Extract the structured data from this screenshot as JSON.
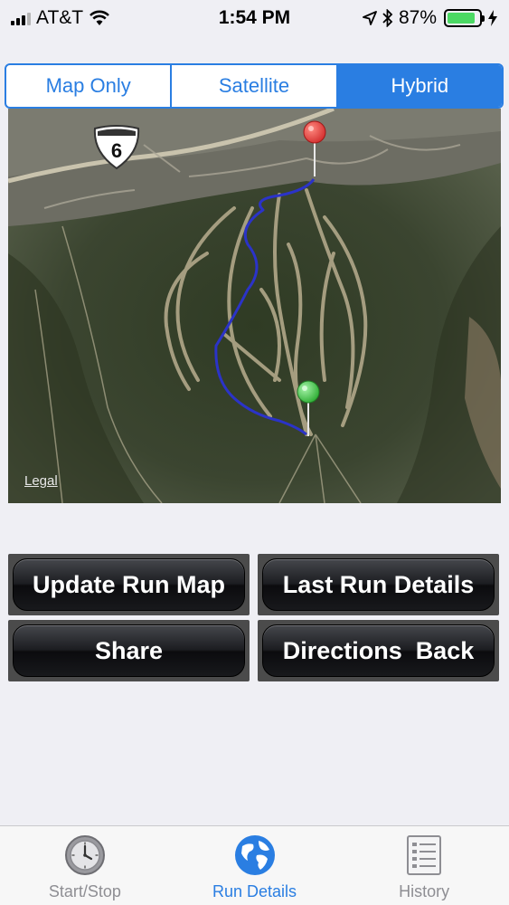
{
  "status_bar": {
    "carrier": "AT&T",
    "time": "1:54 PM",
    "battery_percent": "87%",
    "battery_level": 0.87,
    "battery_color": "#4cd964"
  },
  "map_type": {
    "options": [
      "Map Only",
      "Satellite",
      "Hybrid"
    ],
    "selected": "Hybrid",
    "accent": "#2a7ee2"
  },
  "map": {
    "highway_shield": "6",
    "legal_link": "Legal",
    "start_pin_color": "#e53935",
    "end_pin_color": "#43c447",
    "route_color": "#2b33c8"
  },
  "buttons": {
    "update_run_map": "Update Run Map",
    "last_run_details": "Last Run Details",
    "share": "Share",
    "directions_back": "Directions  Back"
  },
  "tab_bar": {
    "tabs": [
      {
        "label": "Start/Stop",
        "icon": "clock-icon"
      },
      {
        "label": "Run Details",
        "icon": "globe-icon"
      },
      {
        "label": "History",
        "icon": "list-icon"
      }
    ],
    "active": "Run Details"
  }
}
